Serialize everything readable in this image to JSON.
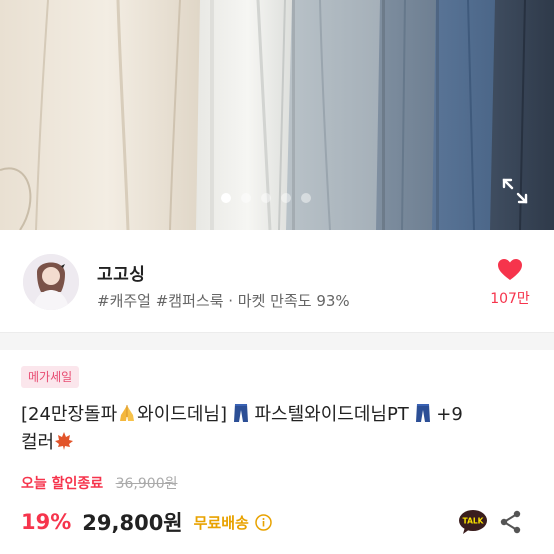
{
  "hero": {
    "slide_count": 5,
    "active_slide": 1
  },
  "seller": {
    "name": "고고싱",
    "tags": "#캐주얼 #캠퍼스룩 · 마켓 만족도 93%"
  },
  "like": {
    "count": "107만"
  },
  "product": {
    "badge": "메가세일",
    "title_parts": {
      "p1": "[24만장돌파",
      "p2": "와이드데님]",
      "p3": "파스텔와이드데님PT",
      "p4": "+9",
      "p5": "컬러"
    },
    "sale_label": "오늘 할인종료",
    "original_price": "36,900원",
    "discount": "19%",
    "price": "29,800원",
    "shipping": "무료배송"
  },
  "icons": {
    "expand": "expand-icon",
    "heart": "heart-icon",
    "info": "info-icon",
    "talk": "kakaotalk-icon",
    "share": "share-icon",
    "pray": "folded-hands-icon",
    "jeans": "jeans-icon",
    "leaf": "maple-leaf-icon"
  },
  "colors": {
    "accent": "#f6344c",
    "shipping": "#e8a200",
    "badge_bg": "#fbe6ec",
    "badge_text": "#e84d73"
  }
}
